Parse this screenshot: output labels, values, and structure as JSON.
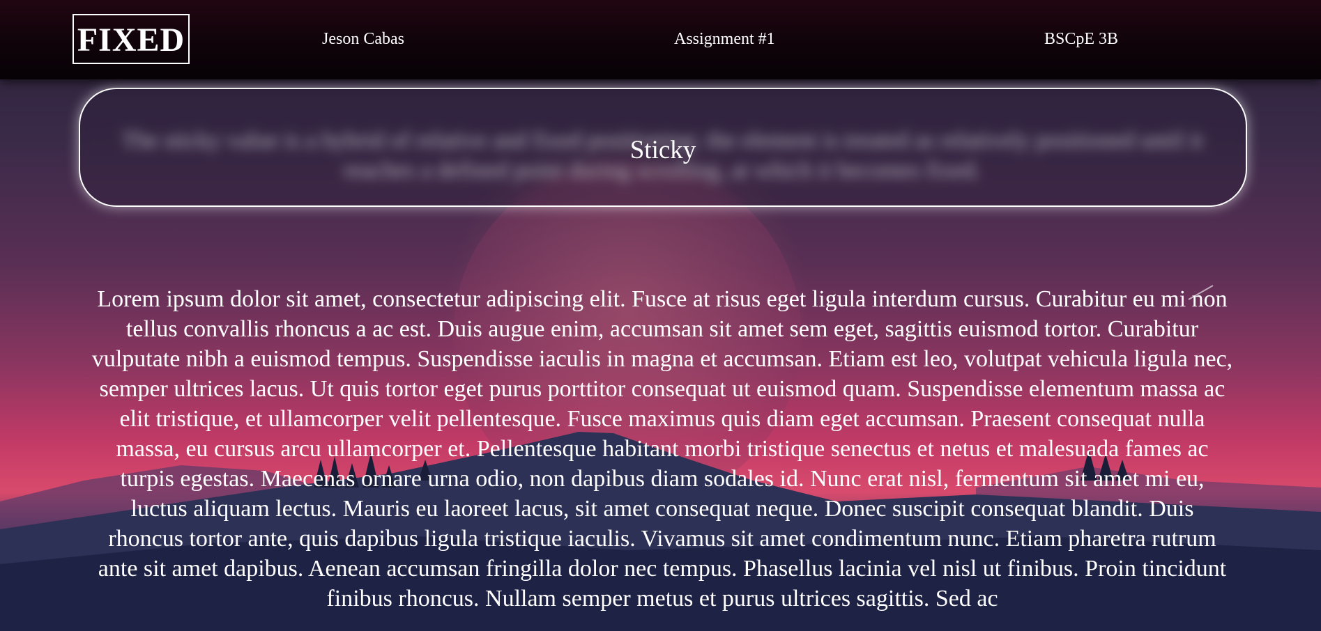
{
  "navbar": {
    "logo": "FIXED",
    "links": [
      "Jeson Cabas",
      "Assignment #1",
      "BSCpE 3B"
    ]
  },
  "sticky": {
    "label": "Sticky"
  },
  "content": {
    "intro": "The sticky value is a hybrid of relative and fixed positioning: the element is treated as relatively positioned until it reaches a defined point during scrolling, at which it becomes fixed.",
    "lorem": "Lorem ipsum dolor sit amet, consectetur adipiscing elit. Fusce at risus eget ligula interdum cursus. Curabitur eu mi non tellus convallis rhoncus a ac est. Duis augue enim, accumsan sit amet sem eget, sagittis euismod tortor. Curabitur vulputate nibh a euismod tempus. Suspendisse iaculis in magna et accumsan. Etiam est leo, volutpat vehicula ligula nec, semper ultrices lacus. Ut quis tortor eget purus porttitor consequat ut euismod quam. Suspendisse elementum massa ac elit tristique, et ullamcorper velit pellentesque. Fusce maximus quis diam eget accumsan. Praesent consequat nulla massa, eu cursus arcu ullamcorper et. Pellentesque habitant morbi tristique senectus et netus et malesuada fames ac turpis egestas. Maecenas ornare urna odio, non dapibus diam sodales id. Nunc erat nisl, fermentum sit amet mi eu, luctus aliquam lectus. Mauris eu laoreet lacus, sit amet consequat neque. Donec suscipit consequat blandit. Duis rhoncus tortor ante, quis dapibus ligula tristique iaculis. Vivamus sit amet condimentum nunc. Etiam pharetra rutrum ante sit amet dapibus. Aenean accumsan fringilla dolor nec tempus. Phasellus lacinia vel nisl ut finibus. Proin tincidunt finibus rhoncus. Nullam semper metus et purus ultrices sagittis. Sed ac"
  },
  "colors": {
    "navbar": "#0e0309",
    "text": "#ffffff",
    "sky_top": "#2a2438",
    "sunset": "#d94a6c",
    "mountain": "#232a4a"
  }
}
